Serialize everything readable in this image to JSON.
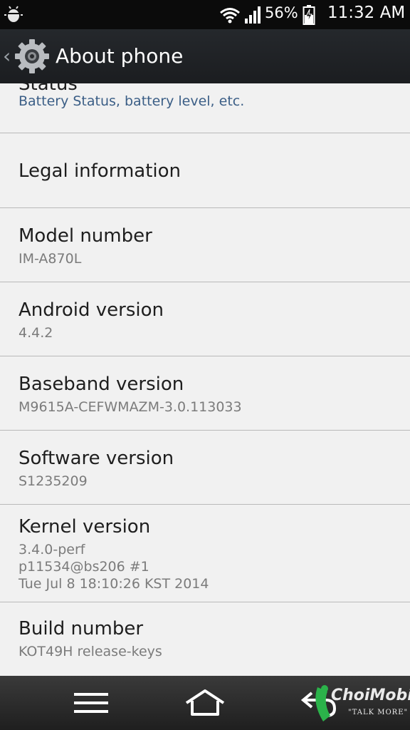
{
  "status_bar": {
    "battery_percent": "56%",
    "time": "11:32 AM",
    "icons": [
      "debug-bug-icon",
      "wifi-icon",
      "signal-icon",
      "battery-charging-icon"
    ]
  },
  "action_bar": {
    "title": "About phone",
    "back_glyph": "‹",
    "icon": "settings-gear-icon"
  },
  "items": [
    {
      "title": "Status",
      "summary": "Battery Status, battery level, etc."
    },
    {
      "title": "Legal information"
    },
    {
      "title": "Model number",
      "summary": "IM-A870L"
    },
    {
      "title": "Android version",
      "summary": "4.4.2"
    },
    {
      "title": "Baseband version",
      "summary": "M9615A-CEFWMAZM-3.0.113033"
    },
    {
      "title": "Software version",
      "summary": "S1235209"
    },
    {
      "title": "Kernel version",
      "summary_lines": [
        "3.4.0-perf",
        "p11534@bs206 #1",
        "Tue Jul 8 18:10:26 KST 2014"
      ]
    },
    {
      "title": "Build number",
      "summary": "KOT49H release-keys"
    }
  ],
  "nav_bar": {
    "icons": [
      "menu-icon",
      "home-icon",
      "back-icon"
    ]
  },
  "watermark": {
    "text": "ChoiMobile",
    "tagline": "\"TALK MORE\""
  },
  "colors": {
    "list_background": "#f1f1f1",
    "summary_blue": "#3b5e86",
    "divider": "#b9b9b9",
    "bars": "#0b0b0b",
    "watermark_green": "#2bb34a"
  }
}
